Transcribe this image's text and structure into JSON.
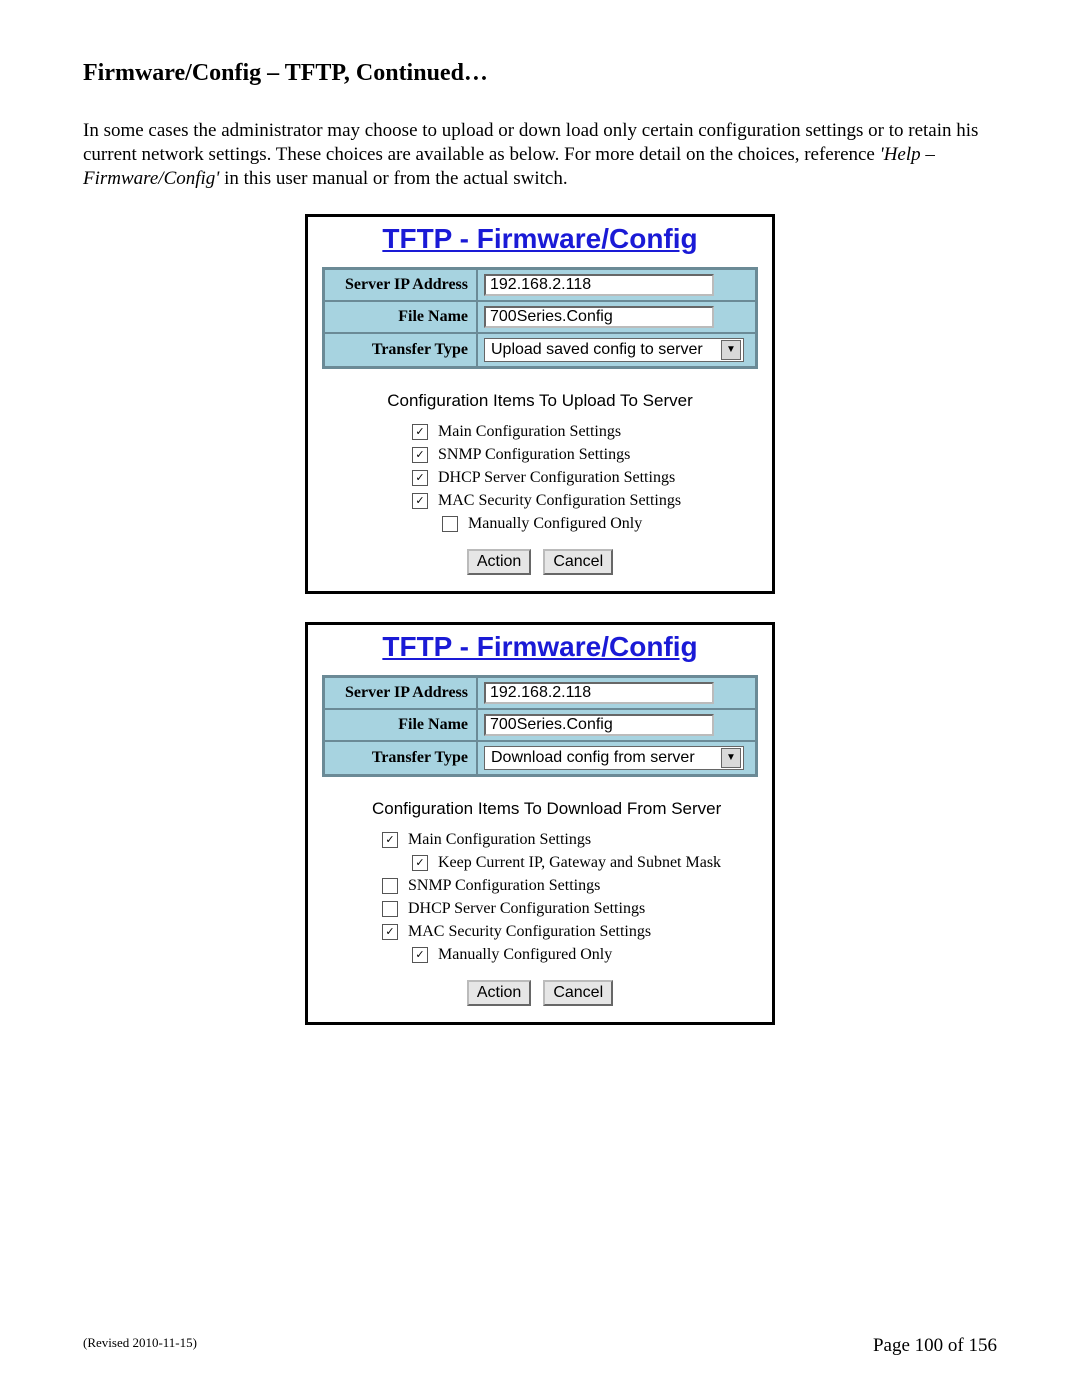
{
  "heading": "Firmware/Config – TFTP, Continued…",
  "body_pre": "In some cases the administrator may choose to upload or down load only certain configuration settings or to retain his current network settings.  These choices are available as below.  For more detail on the choices, reference ",
  "body_italic": "'Help – Firmware/Config'",
  "body_post": " in this user manual or from the actual switch.",
  "panel1": {
    "title": "TFTP - Firmware/Config",
    "rows": {
      "ip_label": "Server IP Address",
      "ip_value": "192.168.2.118",
      "file_label": "File Name",
      "file_value": "700Series.Config",
      "type_label": "Transfer Type",
      "type_value": "Upload saved config to server"
    },
    "subhead": "Configuration Items To Upload To Server",
    "checks": [
      {
        "checked": true,
        "label": "Main Configuration Settings"
      },
      {
        "checked": true,
        "label": "SNMP Configuration Settings"
      },
      {
        "checked": true,
        "label": "DHCP Server Configuration Settings"
      },
      {
        "checked": true,
        "label": "MAC Security Configuration Settings"
      }
    ],
    "sub_check": {
      "checked": false,
      "label": "Manually Configured Only"
    },
    "action": "Action",
    "cancel": "Cancel"
  },
  "panel2": {
    "title": "TFTP - Firmware/Config",
    "rows": {
      "ip_label": "Server IP Address",
      "ip_value": "192.168.2.118",
      "file_label": "File Name",
      "file_value": "700Series.Config",
      "type_label": "Transfer Type",
      "type_value": "Download config from server"
    },
    "subhead": "Configuration Items To Download From Server",
    "checks": [
      {
        "checked": true,
        "label": "Main Configuration Settings",
        "sub": {
          "checked": true,
          "label": "Keep Current IP, Gateway and Subnet Mask"
        }
      },
      {
        "checked": false,
        "label": "SNMP Configuration Settings"
      },
      {
        "checked": false,
        "label": "DHCP Server Configuration Settings"
      },
      {
        "checked": true,
        "label": "MAC Security Configuration Settings",
        "sub": {
          "checked": true,
          "label": "Manually Configured Only"
        }
      }
    ],
    "action": "Action",
    "cancel": "Cancel"
  },
  "footer": {
    "revised": "(Revised 2010-11-15)",
    "page": "Page 100 of 156"
  }
}
